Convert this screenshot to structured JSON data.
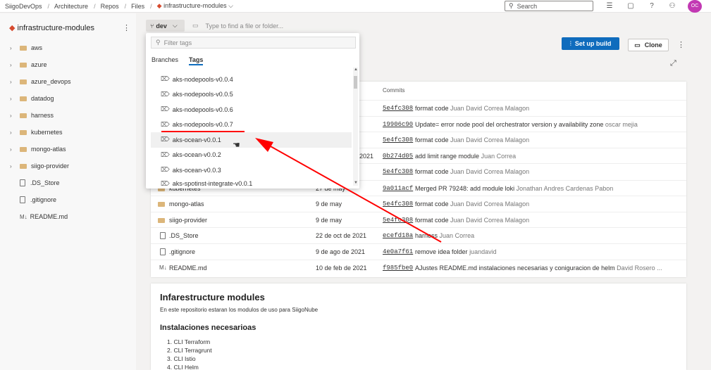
{
  "header": {
    "breadcrumbs": [
      "SiigoDevOps",
      "Architecture",
      "Repos",
      "Files"
    ],
    "repo_crumb": "infrastructure-modules",
    "search_placeholder": "Search",
    "avatar": "OC"
  },
  "sidebar": {
    "repo_name": "infrastructure-modules",
    "folders": [
      "aws",
      "azure",
      "azure_devops",
      "datadog",
      "harness",
      "kubernetes",
      "mongo-atlas",
      "siigo-provider"
    ],
    "files": [
      ".DS_Store",
      ".gitignore"
    ],
    "md_file": "README.md",
    "md_prefix": "M↓"
  },
  "toolbar": {
    "branch": "dev",
    "path_placeholder": "Type to find a file or folder...",
    "setup_build": "Set up build",
    "clone": "Clone"
  },
  "dropdown": {
    "filter_placeholder": "Filter tags",
    "tabs": [
      "Branches",
      "Tags"
    ],
    "tags": [
      "aks-nodepools-v0.0.4",
      "aks-nodepools-v0.0.5",
      "aks-nodepools-v0.0.6",
      "aks-nodepools-v0.0.7",
      "aks-ocean-v0.0.1",
      "aks-ocean-v0.0.2",
      "aks-ocean-v0.0.3",
      "aks-spotinst-integrate-v0.0.1"
    ]
  },
  "files_table": {
    "commits_header": "Commits",
    "partial_rows": [
      {
        "hash": "5e4fc308",
        "msg": "format code",
        "author": "Juan David Correa Malagon"
      },
      {
        "hash": "19906c90",
        "msg": "Update= error node pool del orchestrator version y availability zone",
        "author": "oscar mejia"
      },
      {
        "hash": "5e4fc308",
        "msg": "format code",
        "author": "Juan David Correa Malagon"
      },
      {
        "date": "2021",
        "hash": "0b274d05",
        "msg": "add limit range module",
        "author": "Juan Correa"
      },
      {
        "hash": "5e4fc308",
        "msg": "format code",
        "author": "Juan David Correa Malagon"
      }
    ],
    "rows": [
      {
        "name": "kubernetes",
        "type": "folder",
        "date": "27 de may",
        "hash": "9a011acf",
        "msg": "Merged PR 79248: add module loki",
        "author": "Jonathan Andres Cardenas Pabon"
      },
      {
        "name": "mongo-atlas",
        "type": "folder",
        "date": "9 de may",
        "hash": "5e4fc308",
        "msg": "format code",
        "author": "Juan David Correa Malagon"
      },
      {
        "name": "siigo-provider",
        "type": "folder",
        "date": "9 de may",
        "hash": "5e4fc308",
        "msg": "format code",
        "author": "Juan David Correa Malagon"
      },
      {
        "name": ".DS_Store",
        "type": "file",
        "date": "22 de oct de 2021",
        "hash": "ecefd18a",
        "msg": "harness",
        "author": "Juan Correa"
      },
      {
        "name": ".gitignore",
        "type": "file",
        "date": "9 de ago de 2021",
        "hash": "4e0a7f61",
        "msg": "remove idea folder",
        "author": "juandavid"
      },
      {
        "name": "README.md",
        "type": "md",
        "date": "10 de feb de 2021",
        "hash": "f985fbe0",
        "msg": "AJustes README.md instalaciones necesarias y coniguracion de helm",
        "author": "David Rosero ..."
      }
    ]
  },
  "readme": {
    "title": "Infarestructure modules",
    "intro": "En este repositorio estaran los modulos de uso para SiigoNube",
    "section": "Instalaciones necesarioas",
    "items": [
      "1. CLI Terraform",
      "2. CLI Terragrunt",
      "3. CLI Istio",
      "4. CLI Helm"
    ]
  },
  "colors": {
    "accent": "#0f6cbd",
    "annotation": "#ff0000",
    "folder": "#dcb67a",
    "avatar": "#c239b3"
  }
}
